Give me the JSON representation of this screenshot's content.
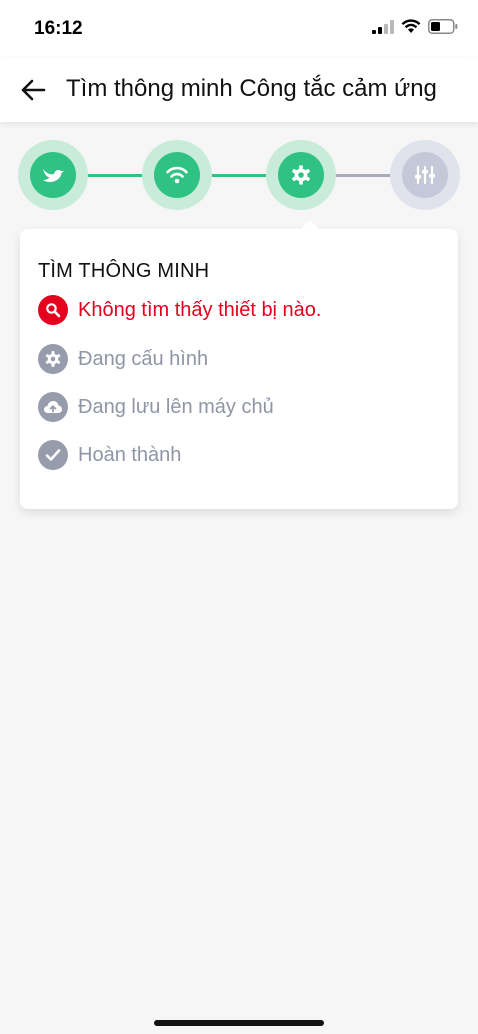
{
  "status_bar": {
    "time": "16:12"
  },
  "header": {
    "title": "Tìm thông minh Công tắc cảm ứng"
  },
  "stepper": {
    "steps": [
      {
        "icon": "bird-icon",
        "state": "done"
      },
      {
        "icon": "wifi-icon",
        "state": "done"
      },
      {
        "icon": "gear-icon",
        "state": "active"
      },
      {
        "icon": "sliders-icon",
        "state": "pending"
      }
    ],
    "colors": {
      "done_inner": "#2fc283",
      "done_outer": "#c8ecd9",
      "pending_inner": "#c4c8d8",
      "pending_outer": "#e0e3ec",
      "line_done": "#2fc283",
      "line_pending": "#a7abbb"
    }
  },
  "card": {
    "title": "TÌM THÔNG MINH",
    "items": [
      {
        "label": "Không tìm thấy thiết bị nào.",
        "icon": "search-icon",
        "state": "error"
      },
      {
        "label": "Đang cấu hình",
        "icon": "gear-icon",
        "state": "pending"
      },
      {
        "label": "Đang lưu lên máy chủ",
        "icon": "cloud-upload-icon",
        "state": "pending"
      },
      {
        "label": "Hoàn thành",
        "icon": "check-icon",
        "state": "pending"
      }
    ],
    "colors": {
      "error": "#e5001e",
      "pending_text": "#9095a6",
      "pending_icon": "#979cad"
    }
  }
}
